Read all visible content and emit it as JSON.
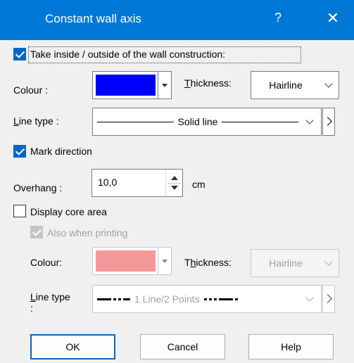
{
  "window": {
    "title": "Constant wall axis",
    "help_glyph": "?",
    "close_glyph": "✕"
  },
  "section1": {
    "take_inside_label": "Take inside / outside of the wall construction:",
    "take_inside_checked": true,
    "colour_label": "Colour :",
    "colour_value": "#0000ff",
    "thickness_label": "Thickness:",
    "thickness_value": "Hairline",
    "linetype_label": "Line type :",
    "linetype_value": "Solid line"
  },
  "mark_direction": {
    "label": "Mark direction",
    "checked": true
  },
  "overhang": {
    "label": "Overhang :",
    "value": "10,0",
    "unit": "cm"
  },
  "core_area": {
    "label": "Display core area",
    "checked": false,
    "also_printing_label": "Also when printing",
    "also_printing_checked": true,
    "colour_label": "Colour:",
    "colour_value": "#f4989a",
    "thickness_label": "Thickness:",
    "thickness_value": "Hairline",
    "linetype_label": "Line type",
    "linetype_colon": ":",
    "linetype_value": "1 Line/2 Points"
  },
  "buttons": {
    "ok": "OK",
    "cancel": "Cancel",
    "help": "Help"
  }
}
